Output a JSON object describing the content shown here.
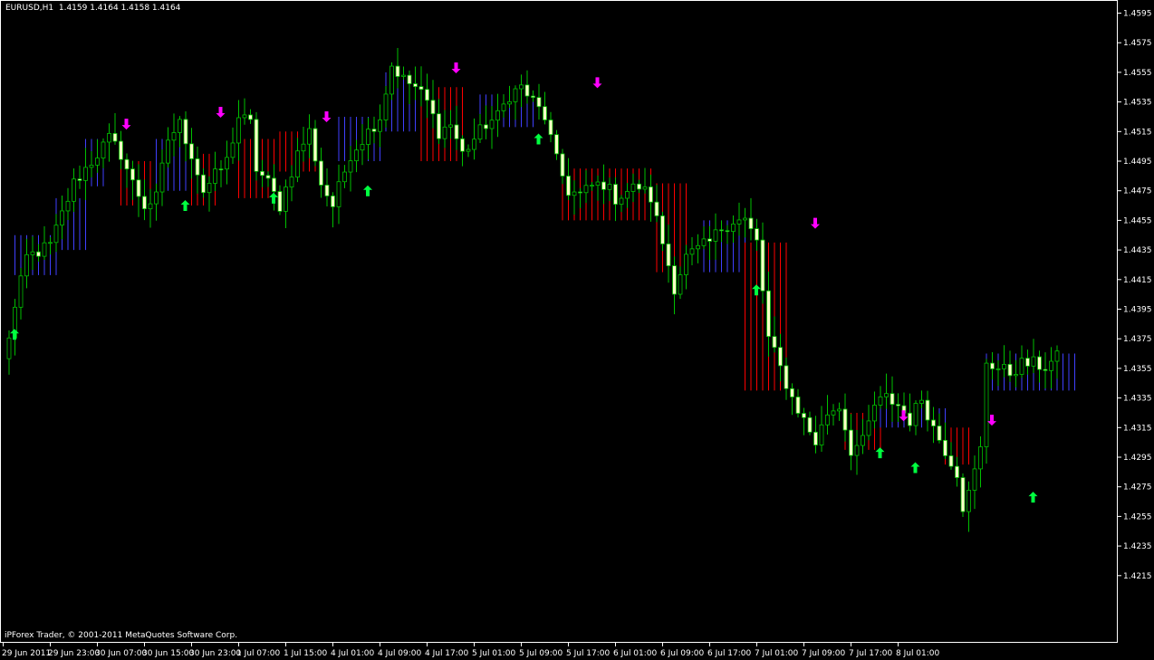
{
  "window": {
    "symbol_timeframe": "EURUSD,H1",
    "ohlc_readout": "1.4159 1.4164 1.4158 1.4164",
    "copyright": "iPForex Trader, © 2001-2011 MetaQuotes Software Corp."
  },
  "colors": {
    "background": "#000000",
    "frame": "#ffffff",
    "bull_body": "#000000",
    "bear_body": "#ffffc8",
    "candle_outline": "#00c000",
    "wick": "#00c000",
    "band_up": "#4040ff",
    "band_down": "#ff0000",
    "arrow_up": "#00ff40",
    "arrow_down": "#ff00ff",
    "axis_text": "#ffffff"
  },
  "chart_data": {
    "type": "candlestick",
    "ylim": [
      1.4205,
      1.4605
    ],
    "y_ticks": [
      "1.4595",
      "1.4575",
      "1.4555",
      "1.4535",
      "1.4515",
      "1.4495",
      "1.4475",
      "1.4455",
      "1.4435",
      "1.4415",
      "1.4395",
      "1.4375",
      "1.4355",
      "1.4335",
      "1.4315",
      "1.4295",
      "1.4275",
      "1.4255",
      "1.4235",
      "1.4215"
    ],
    "x_ticks": [
      "29 Jun 2011",
      "29 Jun 23:00",
      "30 Jun 07:00",
      "30 Jun 15:00",
      "30 Jun 23:00",
      "1 Jul 07:00",
      "1 Jul 15:00",
      "4 Jul 01:00",
      "4 Jul 09:00",
      "4 Jul 17:00",
      "5 Jul 01:00",
      "5 Jul 09:00",
      "5 Jul 17:00",
      "6 Jul 01:00",
      "6 Jul 09:00",
      "6 Jul 17:00",
      "7 Jul 01:00",
      "7 Jul 09:00",
      "7 Jul 17:00",
      "8 Jul 01:00"
    ],
    "bars_per_tick": 8,
    "close_path": [
      [
        0,
        1.436
      ],
      [
        4,
        1.443
      ],
      [
        8,
        1.4438
      ],
      [
        12,
        1.448
      ],
      [
        16,
        1.45
      ],
      [
        18,
        1.451
      ],
      [
        20,
        1.45
      ],
      [
        22,
        1.448
      ],
      [
        24,
        1.4465
      ],
      [
        26,
        1.447
      ],
      [
        28,
        1.451
      ],
      [
        30,
        1.452
      ],
      [
        32,
        1.45
      ],
      [
        34,
        1.4475
      ],
      [
        36,
        1.4485
      ],
      [
        38,
        1.4495
      ],
      [
        40,
        1.4525
      ],
      [
        42,
        1.452
      ],
      [
        43,
        1.449
      ],
      [
        45,
        1.448
      ],
      [
        47,
        1.4465
      ],
      [
        50,
        1.45
      ],
      [
        52,
        1.4515
      ],
      [
        54,
        1.448
      ],
      [
        56,
        1.4465
      ],
      [
        59,
        1.45
      ],
      [
        62,
        1.4515
      ],
      [
        64,
        1.4525
      ],
      [
        66,
        1.456
      ],
      [
        68,
        1.455
      ],
      [
        70,
        1.4545
      ],
      [
        72,
        1.4535
      ],
      [
        74,
        1.4515
      ],
      [
        76,
        1.452
      ],
      [
        78,
        1.45
      ],
      [
        80,
        1.451
      ],
      [
        82,
        1.452
      ],
      [
        84,
        1.4525
      ],
      [
        86,
        1.454
      ],
      [
        88,
        1.4545
      ],
      [
        90,
        1.4535
      ],
      [
        92,
        1.4525
      ],
      [
        94,
        1.4495
      ],
      [
        96,
        1.4475
      ],
      [
        98,
        1.4472
      ],
      [
        100,
        1.4478
      ],
      [
        102,
        1.448
      ],
      [
        104,
        1.447
      ],
      [
        106,
        1.4475
      ],
      [
        108,
        1.4478
      ],
      [
        110,
        1.447
      ],
      [
        112,
        1.444
      ],
      [
        114,
        1.441
      ],
      [
        116,
        1.443
      ],
      [
        118,
        1.4435
      ],
      [
        120,
        1.444
      ],
      [
        122,
        1.445
      ],
      [
        124,
        1.4455
      ],
      [
        126,
        1.4455
      ],
      [
        128,
        1.444
      ],
      [
        130,
        1.4375
      ],
      [
        132,
        1.4355
      ],
      [
        134,
        1.4335
      ],
      [
        136,
        1.432
      ],
      [
        138,
        1.4305
      ],
      [
        140,
        1.4325
      ],
      [
        142,
        1.433
      ],
      [
        144,
        1.43
      ],
      [
        146,
        1.4305
      ],
      [
        148,
        1.433
      ],
      [
        150,
        1.4335
      ],
      [
        152,
        1.433
      ],
      [
        154,
        1.432
      ],
      [
        156,
        1.4335
      ],
      [
        158,
        1.4315
      ],
      [
        160,
        1.43
      ],
      [
        162,
        1.4285
      ],
      [
        163,
        1.4262
      ],
      [
        164,
        1.427
      ],
      [
        166,
        1.43
      ],
      [
        167,
        1.436
      ],
      [
        169,
        1.4355
      ],
      [
        171,
        1.4352
      ],
      [
        173,
        1.4358
      ],
      [
        175,
        1.4358
      ],
      [
        177,
        1.4356
      ],
      [
        179,
        1.4362
      ]
    ],
    "range_bands": [
      [
        2,
        9,
        1.4418,
        1.4445,
        "up"
      ],
      [
        9,
        14,
        1.4435,
        1.447,
        "up"
      ],
      [
        14,
        17,
        1.4478,
        1.451,
        "up"
      ],
      [
        20,
        25,
        1.4465,
        1.4495,
        "down"
      ],
      [
        26,
        31,
        1.4475,
        1.451,
        "up"
      ],
      [
        32,
        36,
        1.4465,
        1.45,
        "down"
      ],
      [
        40,
        46,
        1.447,
        1.451,
        "down"
      ],
      [
        47,
        53,
        1.4488,
        1.4515,
        "down"
      ],
      [
        57,
        64,
        1.4495,
        1.4525,
        "up"
      ],
      [
        65,
        70,
        1.4515,
        1.4555,
        "up"
      ],
      [
        71,
        78,
        1.4495,
        1.4545,
        "down"
      ],
      [
        81,
        90,
        1.4518,
        1.454,
        "up"
      ],
      [
        95,
        110,
        1.4455,
        1.449,
        "down"
      ],
      [
        111,
        116,
        1.442,
        1.448,
        "down"
      ],
      [
        119,
        126,
        1.442,
        1.4455,
        "up"
      ],
      [
        126,
        133,
        1.434,
        1.444,
        "down"
      ],
      [
        143,
        149,
        1.43,
        1.4325,
        "down"
      ],
      [
        149,
        160,
        1.4315,
        1.4328,
        "up"
      ],
      [
        160,
        164,
        1.429,
        1.4315,
        "down"
      ],
      [
        167,
        182,
        1.434,
        1.4365,
        "up"
      ]
    ],
    "arrows": [
      [
        2,
        1.4378,
        "up"
      ],
      [
        21,
        1.452,
        "down"
      ],
      [
        31,
        1.4465,
        "up"
      ],
      [
        37,
        1.4528,
        "down"
      ],
      [
        46,
        1.447,
        "up"
      ],
      [
        55,
        1.4525,
        "down"
      ],
      [
        62,
        1.4475,
        "up"
      ],
      [
        77,
        1.4558,
        "down"
      ],
      [
        91,
        1.451,
        "up"
      ],
      [
        101,
        1.4548,
        "down"
      ],
      [
        128,
        1.4408,
        "up"
      ],
      [
        138,
        1.4453,
        "down"
      ],
      [
        149,
        1.4298,
        "up"
      ],
      [
        153,
        1.4323,
        "down"
      ],
      [
        155,
        1.4288,
        "up"
      ],
      [
        168,
        1.432,
        "down"
      ],
      [
        175,
        1.4268,
        "up"
      ]
    ]
  }
}
